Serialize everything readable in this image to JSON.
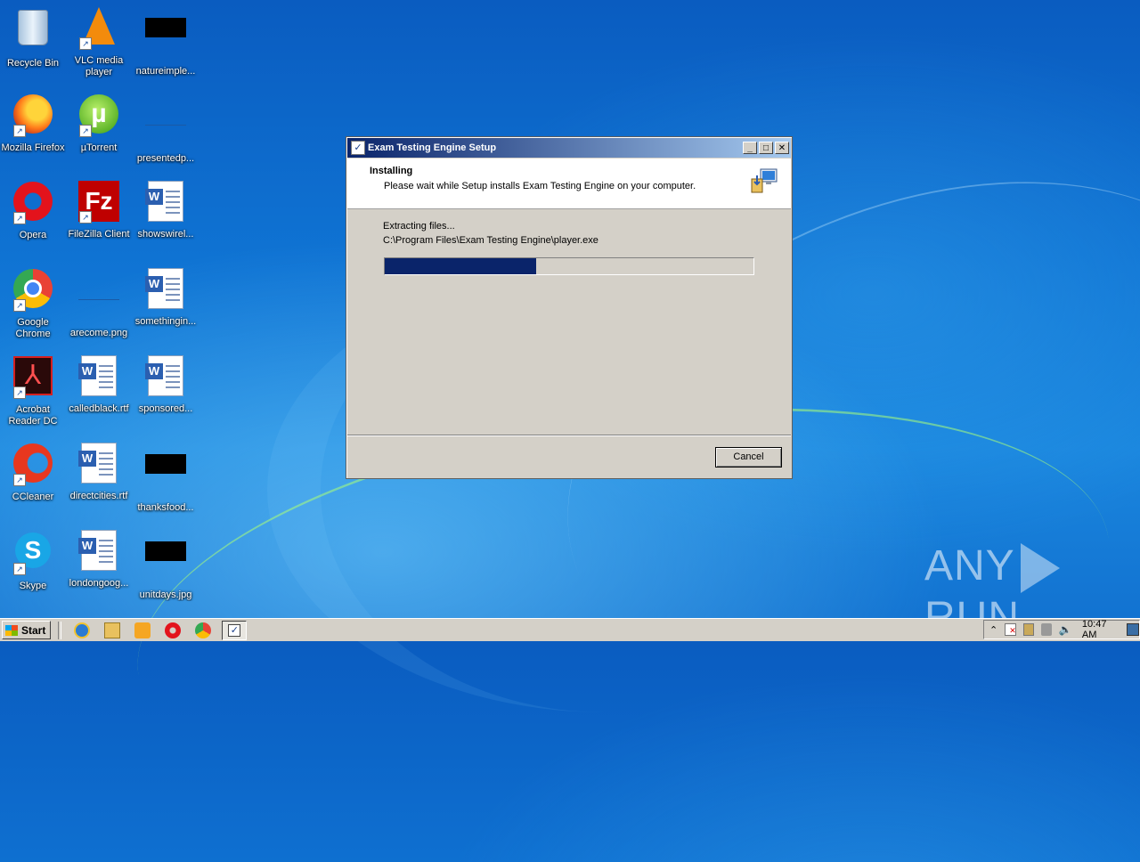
{
  "desktop": {
    "icons": [
      {
        "label": "Recycle Bin",
        "icon": "recycle-bin-icon"
      },
      {
        "label": "VLC media player",
        "icon": "vlc-icon"
      },
      {
        "label": "natureimple...",
        "icon": "file-thumbnail-icon"
      },
      {
        "label": "Mozilla Firefox",
        "icon": "firefox-icon"
      },
      {
        "label": "µTorrent",
        "icon": "utorrent-icon"
      },
      {
        "label": "presentedp...",
        "icon": "file-thumbnail-icon"
      },
      {
        "label": "Opera",
        "icon": "opera-icon"
      },
      {
        "label": "FileZilla Client",
        "icon": "filezilla-icon"
      },
      {
        "label": "showswirel...",
        "icon": "word-document-icon"
      },
      {
        "label": "Google Chrome",
        "icon": "chrome-icon"
      },
      {
        "label": "arecome.png",
        "icon": "image-file-icon"
      },
      {
        "label": "somethingin...",
        "icon": "word-document-icon"
      },
      {
        "label": "Acrobat Reader DC",
        "icon": "acrobat-icon"
      },
      {
        "label": "calledblack.rtf",
        "icon": "word-document-icon"
      },
      {
        "label": "sponsored...",
        "icon": "word-document-icon"
      },
      {
        "label": "CCleaner",
        "icon": "ccleaner-icon"
      },
      {
        "label": "directcities.rtf",
        "icon": "word-document-icon"
      },
      {
        "label": "thanksfood...",
        "icon": "file-thumbnail-icon"
      },
      {
        "label": "Skype",
        "icon": "skype-icon"
      },
      {
        "label": "londongoog...",
        "icon": "word-document-icon"
      },
      {
        "label": "unitdays.jpg",
        "icon": "image-file-icon"
      }
    ]
  },
  "dialog": {
    "title": "Exam Testing Engine Setup",
    "minimize": "_",
    "maximize": "□",
    "close": "✕",
    "heading": "Installing",
    "subheading": "Please wait while Setup installs Exam Testing Engine on your computer.",
    "status": "Extracting files...",
    "current_file": "C:\\Program Files\\Exam Testing Engine\\player.exe",
    "progress_percent": 41,
    "cancel_label": "Cancel"
  },
  "watermark": {
    "left": "ANY",
    "right": "RUN"
  },
  "taskbar": {
    "start_label": "Start",
    "quick_launch": [
      "internet-explorer-icon",
      "explorer-icon",
      "media-player-icon",
      "opera-icon",
      "chrome-icon"
    ],
    "clock": "10:47 AM"
  }
}
